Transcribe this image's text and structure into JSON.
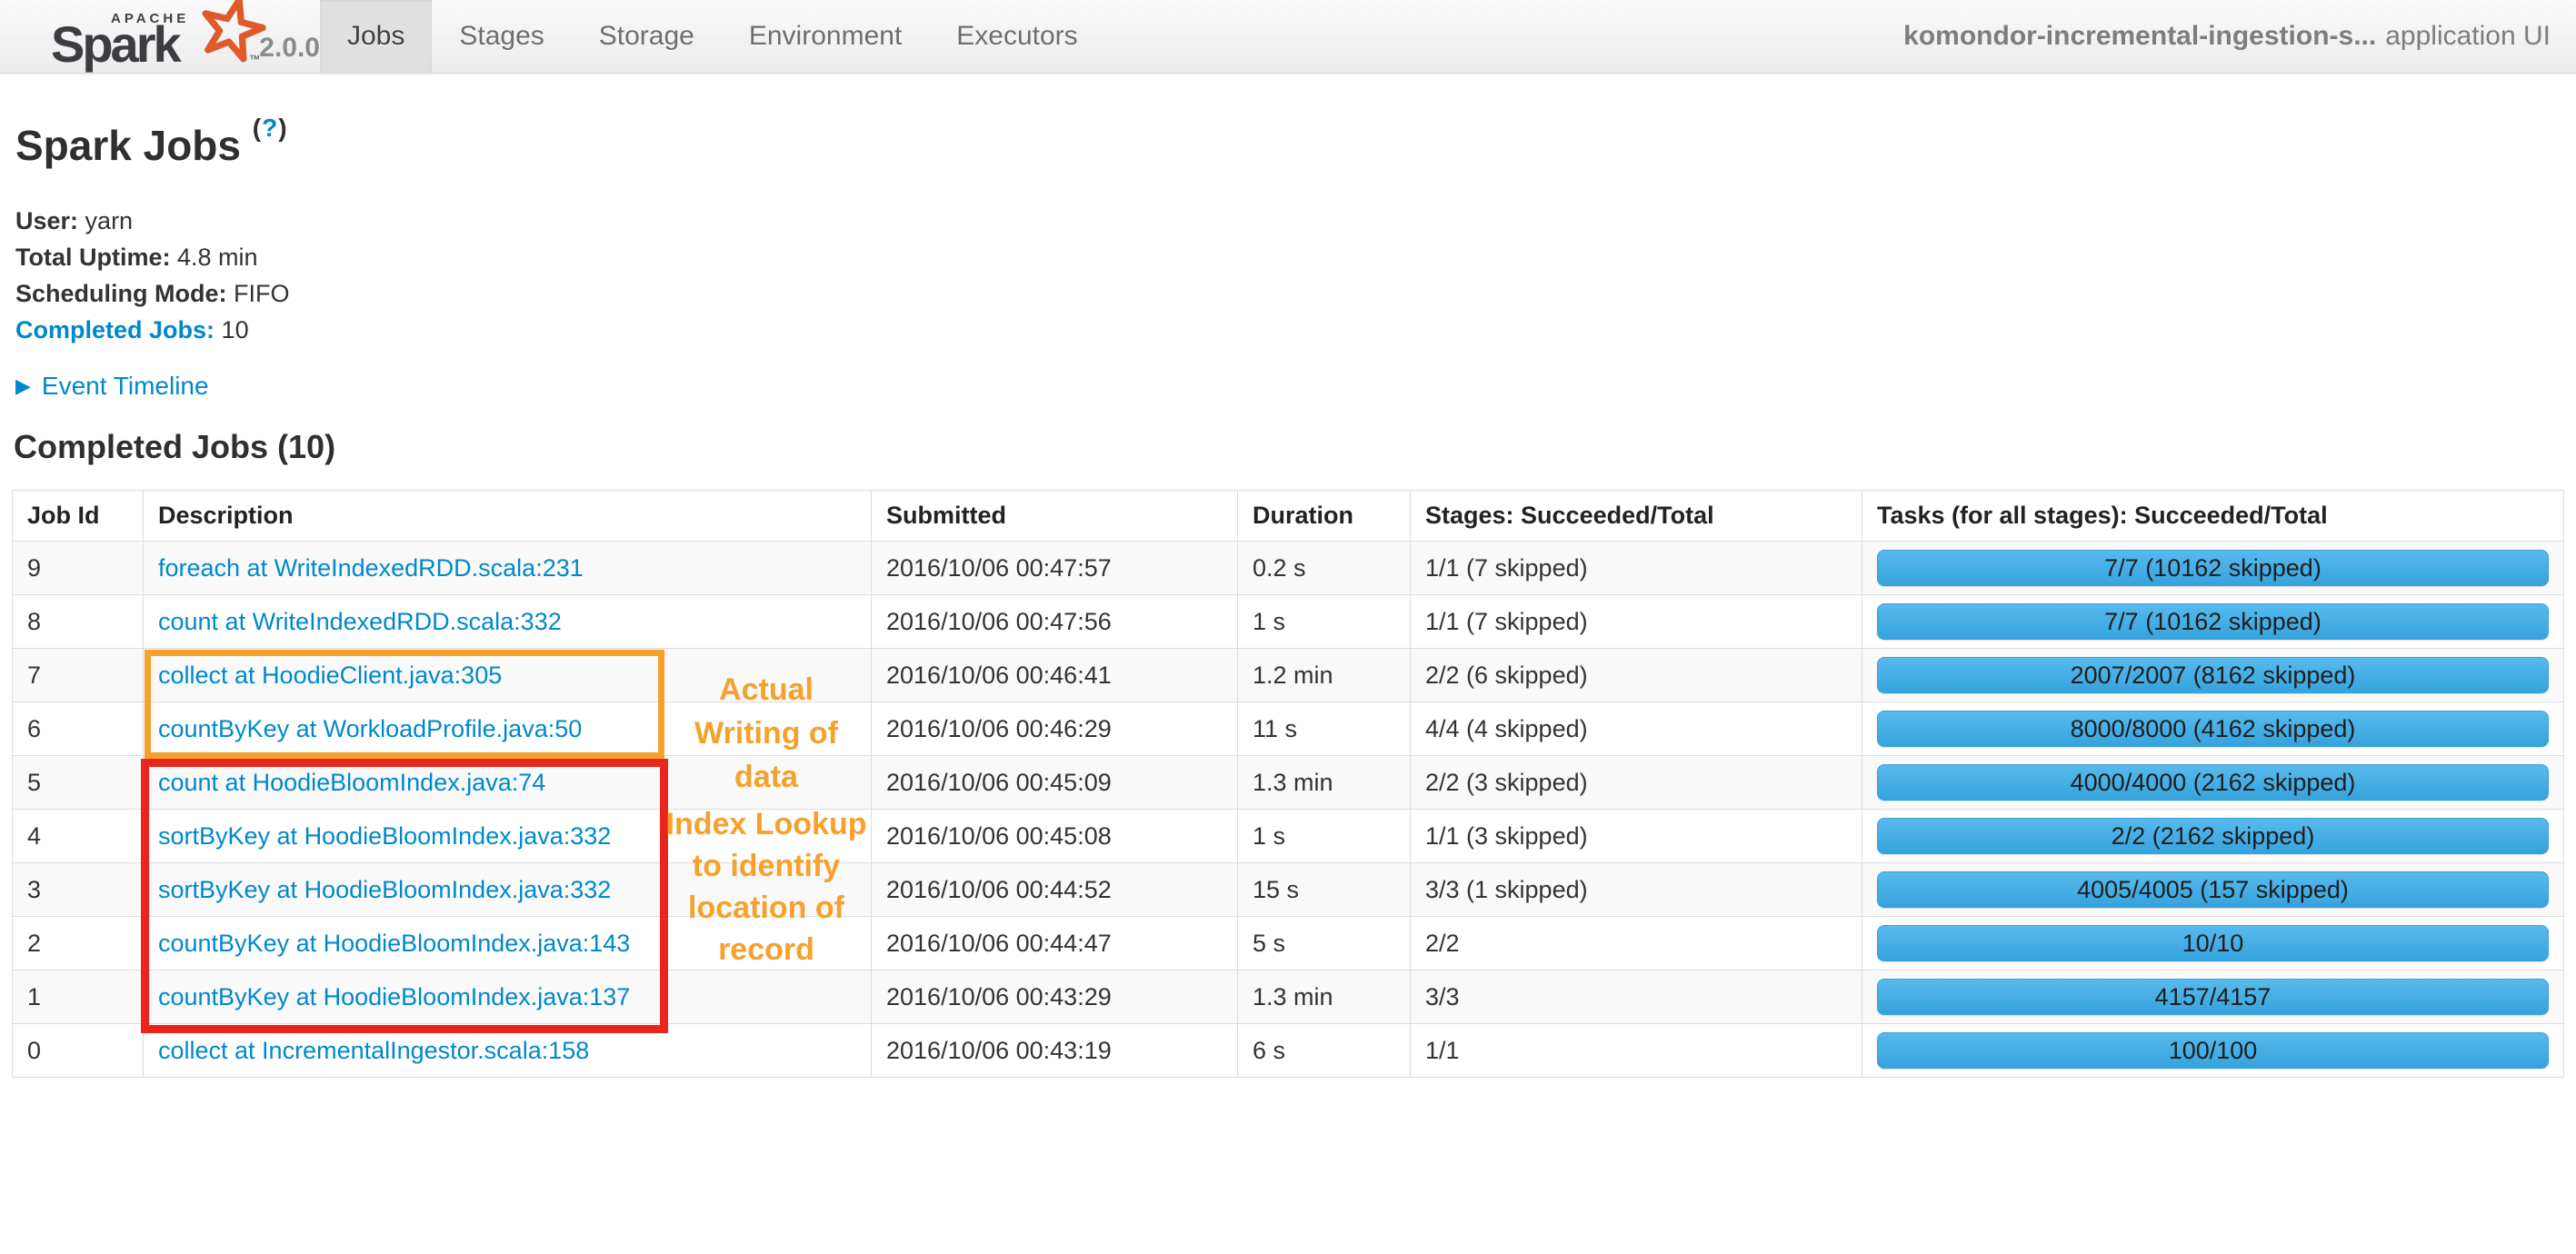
{
  "navbar": {
    "logo": {
      "apache": "APACHE",
      "name": "Spark",
      "trademark": "™",
      "version": "2.0.0"
    },
    "tabs": [
      {
        "label": "Jobs",
        "active": true
      },
      {
        "label": "Stages",
        "active": false
      },
      {
        "label": "Storage",
        "active": false
      },
      {
        "label": "Environment",
        "active": false
      },
      {
        "label": "Executors",
        "active": false
      }
    ],
    "app_title": {
      "name": "komondor-incremental-ingestion-s...",
      "suffix": "application UI"
    }
  },
  "page": {
    "title": "Spark Jobs",
    "help": {
      "open": "(",
      "mark": "?",
      "close": ")"
    },
    "info": [
      {
        "label": "User:",
        "value": "yarn"
      },
      {
        "label": "Total Uptime:",
        "value": "4.8 min"
      },
      {
        "label": "Scheduling Mode:",
        "value": "FIFO"
      },
      {
        "label": "Completed Jobs:",
        "value": "10"
      }
    ],
    "event_timeline": {
      "icon": "▶",
      "label": "Event Timeline"
    },
    "completed_heading": "Completed Jobs (10)"
  },
  "table": {
    "columns": [
      "Job Id",
      "Description",
      "Submitted",
      "Duration",
      "Stages: Succeeded/Total",
      "Tasks (for all stages): Succeeded/Total"
    ],
    "rows": [
      {
        "job_id": "9",
        "description": "foreach at WriteIndexedRDD.scala:231",
        "submitted": "2016/10/06 00:47:57",
        "duration": "0.2 s",
        "stages": "1/1 (7 skipped)",
        "tasks": "7/7 (10162 skipped)",
        "progress_percent": 100
      },
      {
        "job_id": "8",
        "description": "count at WriteIndexedRDD.scala:332",
        "submitted": "2016/10/06 00:47:56",
        "duration": "1 s",
        "stages": "1/1 (7 skipped)",
        "tasks": "7/7 (10162 skipped)",
        "progress_percent": 100
      },
      {
        "job_id": "7",
        "description": "collect at HoodieClient.java:305",
        "submitted": "2016/10/06 00:46:41",
        "duration": "1.2 min",
        "stages": "2/2 (6 skipped)",
        "tasks": "2007/2007 (8162 skipped)",
        "progress_percent": 100
      },
      {
        "job_id": "6",
        "description": "countByKey at WorkloadProfile.java:50",
        "submitted": "2016/10/06 00:46:29",
        "duration": "11 s",
        "stages": "4/4 (4 skipped)",
        "tasks": "8000/8000 (4162 skipped)",
        "progress_percent": 100
      },
      {
        "job_id": "5",
        "description": "count at HoodieBloomIndex.java:74",
        "submitted": "2016/10/06 00:45:09",
        "duration": "1.3 min",
        "stages": "2/2 (3 skipped)",
        "tasks": "4000/4000 (2162 skipped)",
        "progress_percent": 100
      },
      {
        "job_id": "4",
        "description": "sortByKey at HoodieBloomIndex.java:332",
        "submitted": "2016/10/06 00:45:08",
        "duration": "1 s",
        "stages": "1/1 (3 skipped)",
        "tasks": "2/2 (2162 skipped)",
        "progress_percent": 100
      },
      {
        "job_id": "3",
        "description": "sortByKey at HoodieBloomIndex.java:332",
        "submitted": "2016/10/06 00:44:52",
        "duration": "15 s",
        "stages": "3/3 (1 skipped)",
        "tasks": "4005/4005 (157 skipped)",
        "progress_percent": 100
      },
      {
        "job_id": "2",
        "description": "countByKey at HoodieBloomIndex.java:143",
        "submitted": "2016/10/06 00:44:47",
        "duration": "5 s",
        "stages": "2/2",
        "tasks": "10/10",
        "progress_percent": 100
      },
      {
        "job_id": "1",
        "description": "countByKey at HoodieBloomIndex.java:137",
        "submitted": "2016/10/06 00:43:29",
        "duration": "1.3 min",
        "stages": "3/3",
        "tasks": "4157/4157",
        "progress_percent": 100
      },
      {
        "job_id": "0",
        "description": "collect at IncrementalIngestor.scala:158",
        "submitted": "2016/10/06 00:43:19",
        "duration": "6 s",
        "stages": "1/1",
        "tasks": "100/100",
        "progress_percent": 100
      }
    ]
  },
  "annotations": {
    "writing": {
      "lines": [
        "Actual",
        "Writing of",
        "data"
      ],
      "box_color": "#f5a12b"
    },
    "index_lookup": {
      "lines": [
        "Index Lookup",
        "to identify",
        "location of",
        "record"
      ],
      "box_color": "#e9251d"
    },
    "text_color": "#f6a12c"
  },
  "colors": {
    "link_blue": "#0088cc",
    "progress_blue": "#47afe6",
    "row_stripe": "#f9f9f9",
    "navbar_active_tab": "#e0e0e0"
  }
}
